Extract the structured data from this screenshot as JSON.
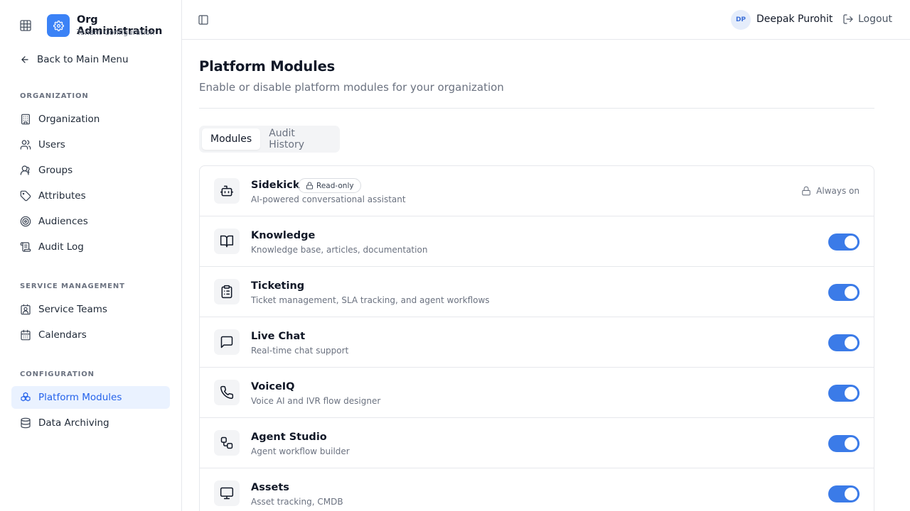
{
  "brand": {
    "title": "Org Administration",
    "subtitle": "Tenant Configuration",
    "accent": "#3b82f6"
  },
  "back_label": "Back to Main Menu",
  "sidebar": {
    "sections": [
      {
        "label": "ORGANIZATION",
        "items": [
          {
            "label": "Organization",
            "icon": "building-icon"
          },
          {
            "label": "Users",
            "icon": "users-icon"
          },
          {
            "label": "Groups",
            "icon": "groups-icon"
          },
          {
            "label": "Attributes",
            "icon": "tag-icon"
          },
          {
            "label": "Audiences",
            "icon": "target-icon"
          },
          {
            "label": "Audit Log",
            "icon": "scroll-icon"
          }
        ]
      },
      {
        "label": "SERVICE MANAGEMENT",
        "items": [
          {
            "label": "Service Teams",
            "icon": "contact-icon"
          },
          {
            "label": "Calendars",
            "icon": "calendar-icon"
          }
        ]
      },
      {
        "label": "CONFIGURATION",
        "items": [
          {
            "label": "Platform Modules",
            "icon": "boxes-icon",
            "active": true
          },
          {
            "label": "Data Archiving",
            "icon": "database-icon"
          }
        ]
      }
    ]
  },
  "header": {
    "avatar_initials": "DP",
    "user_name": "Deepak Purohit",
    "logout_label": "Logout"
  },
  "page": {
    "title": "Platform Modules",
    "subtitle": "Enable or disable platform modules for your organization",
    "tabs": [
      {
        "label": "Modules",
        "active": true
      },
      {
        "label": "Audit History",
        "active": false
      }
    ]
  },
  "modules": [
    {
      "name": "Sidekick",
      "desc": "AI-powered conversational assistant",
      "icon": "bot-icon",
      "badge": "Read-only",
      "status": "Always on"
    },
    {
      "name": "Knowledge",
      "desc": "Knowledge base, articles, documentation",
      "icon": "book-open-icon",
      "enabled": true
    },
    {
      "name": "Ticketing",
      "desc": "Ticket management, SLA tracking, and agent workflows",
      "icon": "clipboard-list-icon",
      "enabled": true
    },
    {
      "name": "Live Chat",
      "desc": "Real-time chat support",
      "icon": "message-square-icon",
      "enabled": true
    },
    {
      "name": "VoiceIQ",
      "desc": "Voice AI and IVR flow designer",
      "icon": "phone-icon",
      "enabled": true
    },
    {
      "name": "Agent Studio",
      "desc": "Agent workflow builder",
      "icon": "workflow-icon",
      "enabled": true
    },
    {
      "name": "Assets",
      "desc": "Asset tracking, CMDB",
      "icon": "monitor-icon",
      "enabled": true
    }
  ],
  "colors": {
    "toggle_on": "#3b7be8",
    "active_nav_bg": "#eaf2ff",
    "active_nav_text": "#2563eb"
  }
}
